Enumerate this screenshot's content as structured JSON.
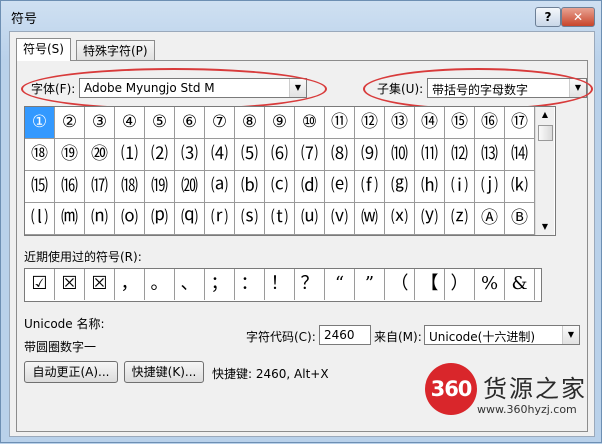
{
  "window": {
    "title": "符号"
  },
  "titlebar": {
    "help": "?",
    "close": "✕"
  },
  "tabs": [
    {
      "label": "符号(S)"
    },
    {
      "label": "特殊字符(P)"
    }
  ],
  "font": {
    "label": "字体(F):",
    "value": "Adobe Myungjo Std M"
  },
  "subset": {
    "label": "子集(U):",
    "value": "带括号的字母数字"
  },
  "symbols": [
    [
      "①",
      "②",
      "③",
      "④",
      "⑤",
      "⑥",
      "⑦",
      "⑧",
      "⑨",
      "⑩",
      "⑪",
      "⑫",
      "⑬",
      "⑭",
      "⑮",
      "⑯",
      "⑰"
    ],
    [
      "⑱",
      "⑲",
      "⑳",
      "⑴",
      "⑵",
      "⑶",
      "⑷",
      "⑸",
      "⑹",
      "⑺",
      "⑻",
      "⑼",
      "⑽",
      "⑾",
      "⑿",
      "⒀",
      "⒁"
    ],
    [
      "⒂",
      "⒃",
      "⒄",
      "⒅",
      "⒆",
      "⒇",
      "⒜",
      "⒝",
      "⒞",
      "⒟",
      "⒠",
      "⒡",
      "⒢",
      "⒣",
      "⒤",
      "⒥",
      "⒦"
    ],
    [
      "⒧",
      "⒨",
      "⒩",
      "⒪",
      "⒫",
      "⒬",
      "⒭",
      "⒮",
      "⒯",
      "⒰",
      "⒱",
      "⒲",
      "⒳",
      "⒴",
      "⒵",
      "Ⓐ",
      "Ⓑ"
    ]
  ],
  "recent": {
    "label": "近期使用过的符号(R):",
    "items": [
      "☑",
      "☒",
      "☒",
      "，",
      "。",
      "、",
      "；",
      "：",
      "！",
      "？",
      "“",
      "”",
      "（",
      "【",
      "）",
      "%",
      "&"
    ]
  },
  "unicode": {
    "label": "Unicode 名称:",
    "name": "带圆圈数字一"
  },
  "charcode": {
    "label": "字符代码(C):",
    "value": "2460"
  },
  "from": {
    "label": "来自(M):",
    "value": "Unicode(十六进制)"
  },
  "buttons": {
    "autocorrect": "自动更正(A)...",
    "shortcut": "快捷键(K)..."
  },
  "shortcut_text": "快捷键: 2460, Alt+X",
  "watermark": {
    "number": "360",
    "name": "货源之家",
    "url": "www.360hyzj.com"
  },
  "colors": {
    "accent": "#d83b3b",
    "selection": "#3399ff"
  }
}
